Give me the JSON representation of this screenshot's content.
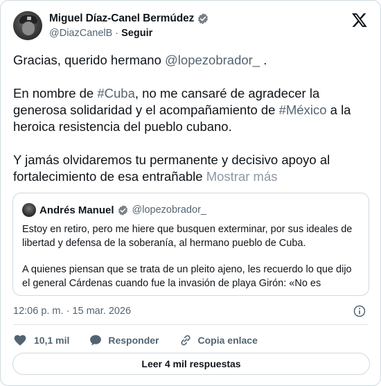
{
  "author": {
    "name": "Miguel Díaz-Canel Bermúdez",
    "handle": "@DiazCanelB",
    "separator": "·",
    "follow_label": "Seguir",
    "verified_icon": "verified-badge-icon"
  },
  "post": {
    "p1_text": "Gracias, querido hermano ",
    "p1_mention": "@lopezobrador_",
    "p1_end": " .",
    "p2_a": "En nombre de ",
    "p2_tag1": "#Cuba",
    "p2_b": ", no me cansaré de agradecer la generosa solidaridad y el acompañamiento de ",
    "p2_tag2": "#México",
    "p2_c": " a la heroica resistencia del pueblo cubano.",
    "p3_a": "Y jamás olvidaremos tu permanente y decisivo apoyo al fortalecimiento de esa entrañable ",
    "show_more": "Mostrar más"
  },
  "quote": {
    "name": "Andrés Manuel",
    "handle": "@lopezobrador_",
    "para1": "Estoy en retiro, pero me hiere que busquen exterminar, por sus ideales de libertad y defensa de la soberanía, al hermano pueblo de Cuba.",
    "para2": "A quienes piensan que se trata de un pleito ajeno, les recuerdo lo que dijo el general Cárdenas cuando fue la invasión de playa Girón: «No es"
  },
  "meta": {
    "timestamp": "12:06 p. m. · 15 mar. 2026"
  },
  "actions": {
    "likes": "10,1 mil",
    "reply_label": "Responder",
    "copy_link_label": "Copia enlace"
  },
  "replies_button": "Leer 4 mil respuestas",
  "colors": {
    "text": "#0f1419",
    "secondary": "#536471",
    "border": "#cfd9de"
  }
}
